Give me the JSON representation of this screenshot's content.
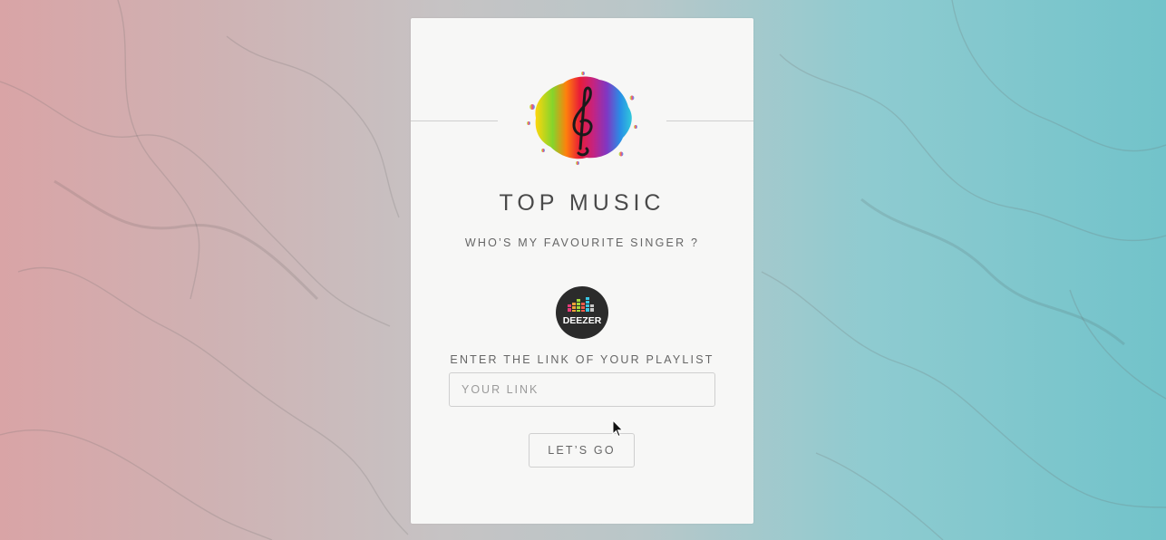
{
  "app": {
    "title": "TOP MUSIC",
    "subtitle": "WHO’S MY FAVOURITE SINGER ?"
  },
  "logo": {
    "icon": "treble-clef-splash-icon"
  },
  "deezer": {
    "label": "DEEZER",
    "icon": "deezer-logo-icon"
  },
  "form": {
    "link_label": "ENTER THE LINK OF YOUR PLAYLIST",
    "link_value": "",
    "link_placeholder": "YOUR LINK",
    "submit_label": "LET’S GO"
  },
  "colors": {
    "card_background": "#f7f7f6",
    "background_left": "#d9a4a6",
    "background_right": "#72c3ca",
    "text": "#4a4a4a"
  }
}
